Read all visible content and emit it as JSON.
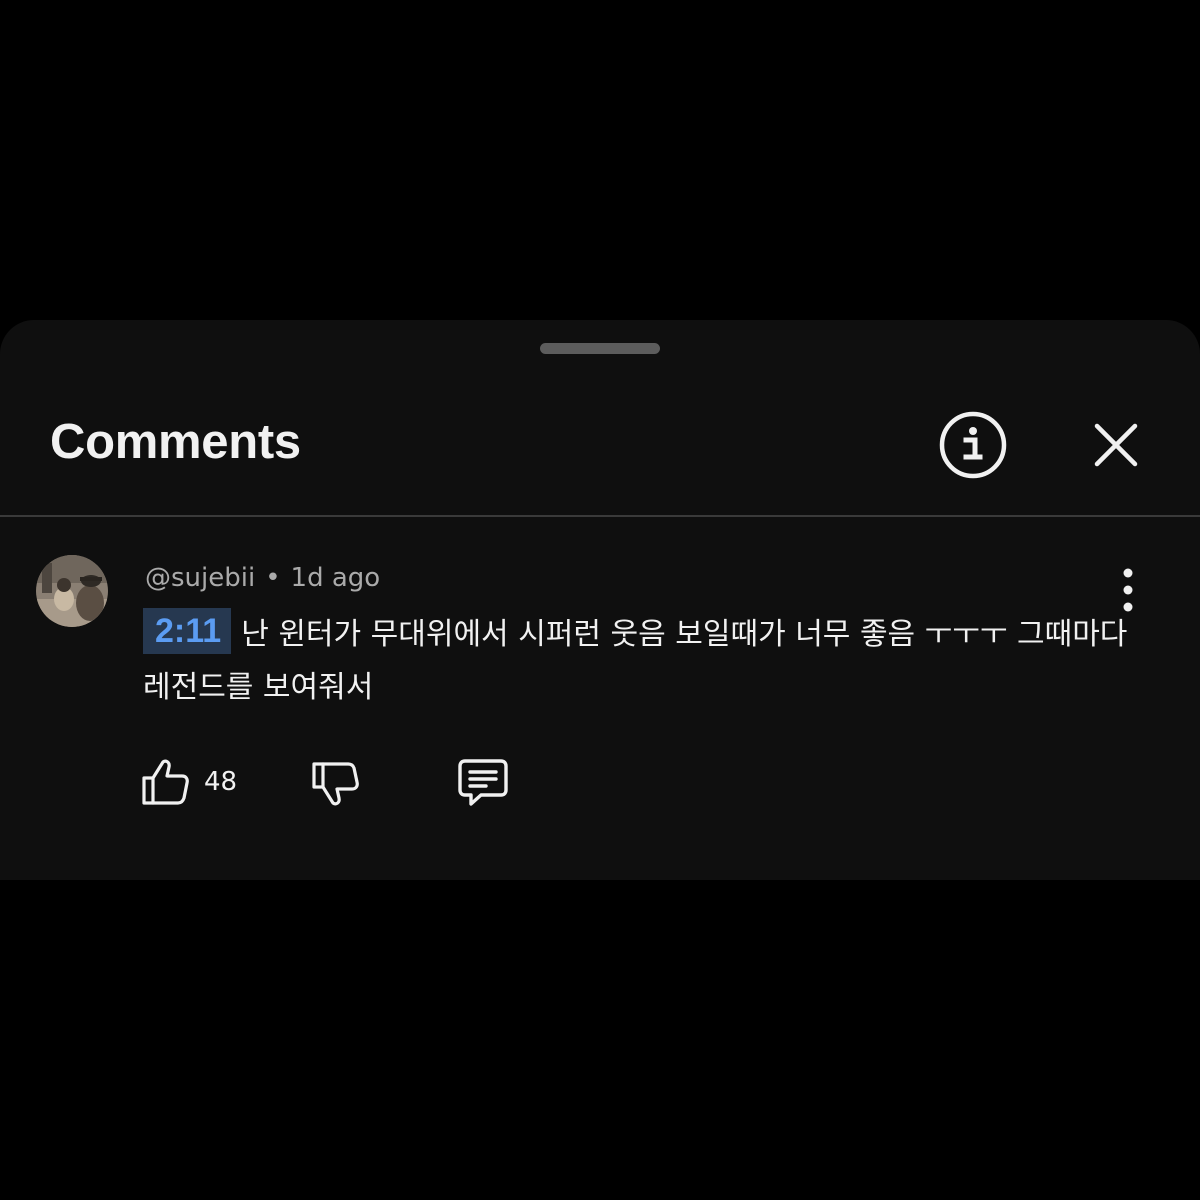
{
  "sheet": {
    "title": "Comments",
    "info_icon": "info-icon",
    "close_icon": "close-icon"
  },
  "comment": {
    "author": "@sujebii",
    "separator": "•",
    "time": "1d ago",
    "timestamp_link": "2:11",
    "text": "난 윈터가 무대위에서 시퍼런 웃음 보일때가 너무 좋음 ㅜㅜㅜ 그때마다 레전드를 보여줘서",
    "more_icon": "more-vert-icon",
    "like_icon": "thumb-up-icon",
    "like_count": "48",
    "dislike_icon": "thumb-down-icon",
    "reply_icon": "reply-comment-icon"
  },
  "colors": {
    "background": "#000000",
    "sheet": "#0f0f0f",
    "text_primary": "#f1f1f1",
    "text_secondary": "#aaaaaa",
    "timestamp_link": "#5b9cf2",
    "timestamp_bg": "#263850"
  }
}
